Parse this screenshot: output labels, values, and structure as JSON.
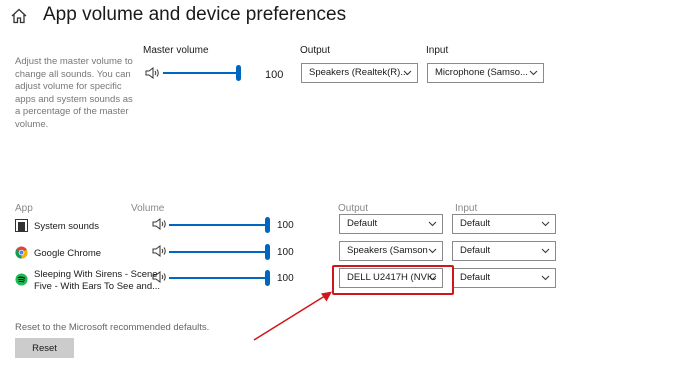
{
  "header": {
    "title": "App volume and device preferences",
    "home_icon": "home-icon"
  },
  "master": {
    "description": "Adjust the master volume to change all sounds. You can adjust volume for specific apps and system sounds as a percentage of the master volume.",
    "volume_label": "Master volume",
    "volume_value": "100",
    "volume_level_percent": 100,
    "output_label": "Output",
    "output_value": "Speakers (Realtek(R)...",
    "input_label": "Input",
    "input_value": "Microphone (Samso..."
  },
  "apps_table": {
    "headers": {
      "app": "App",
      "volume": "Volume",
      "output": "Output",
      "input": "Input"
    },
    "rows": [
      {
        "name": "System sounds",
        "icon": "system-sounds-icon",
        "volume": "100",
        "volume_level_percent": 100,
        "output": "Default",
        "input": "Default"
      },
      {
        "name": "Google Chrome",
        "icon": "chrome-icon",
        "volume": "100",
        "volume_level_percent": 100,
        "output": "Speakers (Samson",
        "input": "Default"
      },
      {
        "name_line1": "Sleeping With Sirens - Scene",
        "name_line2": "Five - With Ears To See and...",
        "icon": "spotify-icon",
        "volume": "100",
        "volume_level_percent": 100,
        "output": "DELL U2417H (NVIC",
        "input": "Default"
      }
    ]
  },
  "reset": {
    "description": "Reset to the Microsoft recommended defaults.",
    "button_label": "Reset"
  },
  "colors": {
    "accent": "#0067c0",
    "annotation": "#d0161a",
    "button_bg": "#cccccc"
  }
}
